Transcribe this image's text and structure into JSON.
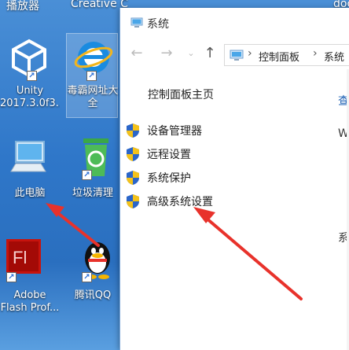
{
  "desktop": {
    "top_left_label": "播放器",
    "top_right_label": "Creative C",
    "top_far_label": "doc",
    "icons": [
      {
        "name": "unity",
        "label_line1": "Unity",
        "label_line2": "2017.3.0f3..."
      },
      {
        "name": "browser",
        "label_line1": "毒霸网址大",
        "label_line2": "全"
      },
      {
        "name": "this-pc",
        "label_line1": "此电脑"
      },
      {
        "name": "recycle-bin",
        "label_line1": "垃圾清理"
      },
      {
        "name": "adobe-flash",
        "label_line1": "Adobe",
        "label_line2": "Flash Prof..."
      },
      {
        "name": "qq",
        "label_line1": "腾讯QQ"
      }
    ]
  },
  "window": {
    "title": "系统",
    "address": {
      "crumb1": "控制面板",
      "crumb2": "系统"
    },
    "home_link": "控制面板主页",
    "tasks": [
      {
        "label": "设备管理器"
      },
      {
        "label": "远程设置"
      },
      {
        "label": "系统保护"
      },
      {
        "label": "高级系统设置"
      }
    ],
    "right_fragments": {
      "view": "查",
      "w": "W",
      "sys": "系"
    }
  },
  "colors": {
    "desktop_blue": "#2f77c9",
    "arrow_red": "#e8322b",
    "shield_blue": "#2b66c9",
    "shield_yellow": "#f4c21a"
  }
}
